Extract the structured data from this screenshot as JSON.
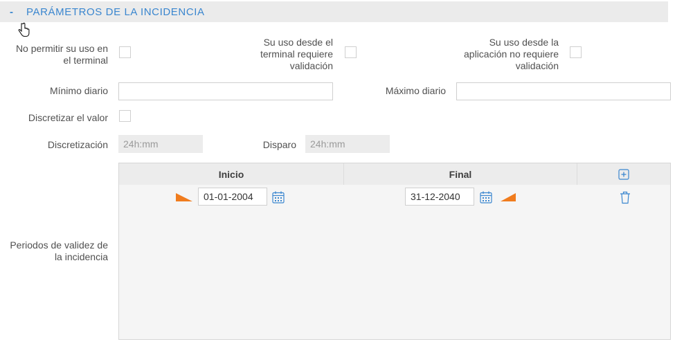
{
  "section": {
    "toggle": "-",
    "title": "PARÁMETROS DE LA INCIDENCIA"
  },
  "fields": {
    "no_permitir": "No permitir su uso en el terminal",
    "terminal_validacion": "Su uso desde el terminal requiere validación",
    "aplicacion_validacion": "Su uso desde la aplicación no requiere validación",
    "minimo_diario": "Mínimo diario",
    "maximo_diario": "Máximo diario",
    "discretizar": "Discretizar el valor",
    "discretizacion": "Discretización",
    "discretizacion_placeholder": "24h:mm",
    "disparo": "Disparo",
    "disparo_placeholder": "24h:mm",
    "periodos": "Periodos de validez de la incidencia"
  },
  "table": {
    "columns": [
      "Inicio",
      "Final"
    ],
    "rows": [
      {
        "inicio": "01-01-2004",
        "final": "31-12-2040"
      }
    ]
  },
  "colors": {
    "accent": "#3a86cf",
    "marker": "#f07c1e"
  }
}
